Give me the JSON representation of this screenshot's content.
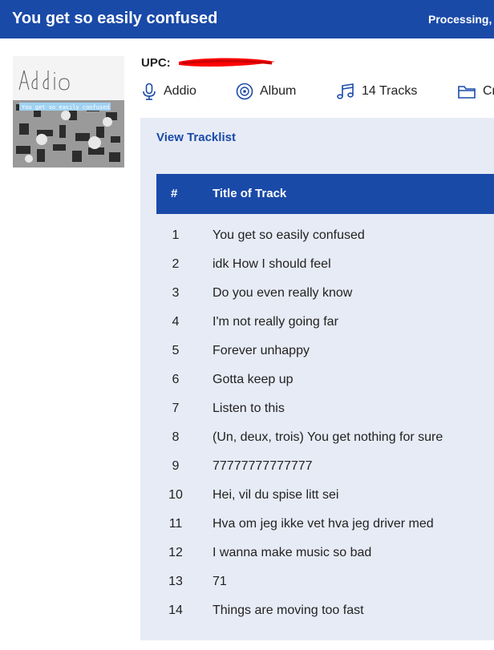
{
  "header": {
    "title": "You get so easily confused",
    "status": "Processing,"
  },
  "cover": {
    "handwritten_text": "Addio",
    "caption_text": "You get so easily confused"
  },
  "upc": {
    "label": "UPC:",
    "value_redacted": true
  },
  "meta": {
    "artist": "Addio",
    "type": "Album",
    "tracks": "14 Tracks",
    "extra": "Cr"
  },
  "tracklist": {
    "link": "View Tracklist",
    "columns": [
      "#",
      "Title of Track"
    ],
    "rows": [
      {
        "num": "1",
        "title": "You get so easily confused"
      },
      {
        "num": "2",
        "title": "idk How I should feel"
      },
      {
        "num": "3",
        "title": "Do you even really know"
      },
      {
        "num": "4",
        "title": "I'm not really going far"
      },
      {
        "num": "5",
        "title": "Forever unhappy"
      },
      {
        "num": "6",
        "title": "Gotta keep up"
      },
      {
        "num": "7",
        "title": "Listen to this"
      },
      {
        "num": "8",
        "title": "(Un, deux, trois) You get nothing for sure"
      },
      {
        "num": "9",
        "title": "77777777777777"
      },
      {
        "num": "10",
        "title": "Hei, vil du spise litt sei"
      },
      {
        "num": "11",
        "title": "Hva om jeg ikke vet hva jeg driver med"
      },
      {
        "num": "12",
        "title": "I wanna make music so bad"
      },
      {
        "num": "13",
        "title": "71"
      },
      {
        "num": "14",
        "title": "Things are moving too fast"
      }
    ]
  },
  "colors": {
    "accent": "#1a4aa8",
    "panel_bg": "#e7ebf5",
    "redaction": "#ff0000"
  },
  "icons": {
    "artist": "microphone-icon",
    "type": "vinyl-icon",
    "tracks": "music-note-icon",
    "extra": "folder-icon"
  }
}
